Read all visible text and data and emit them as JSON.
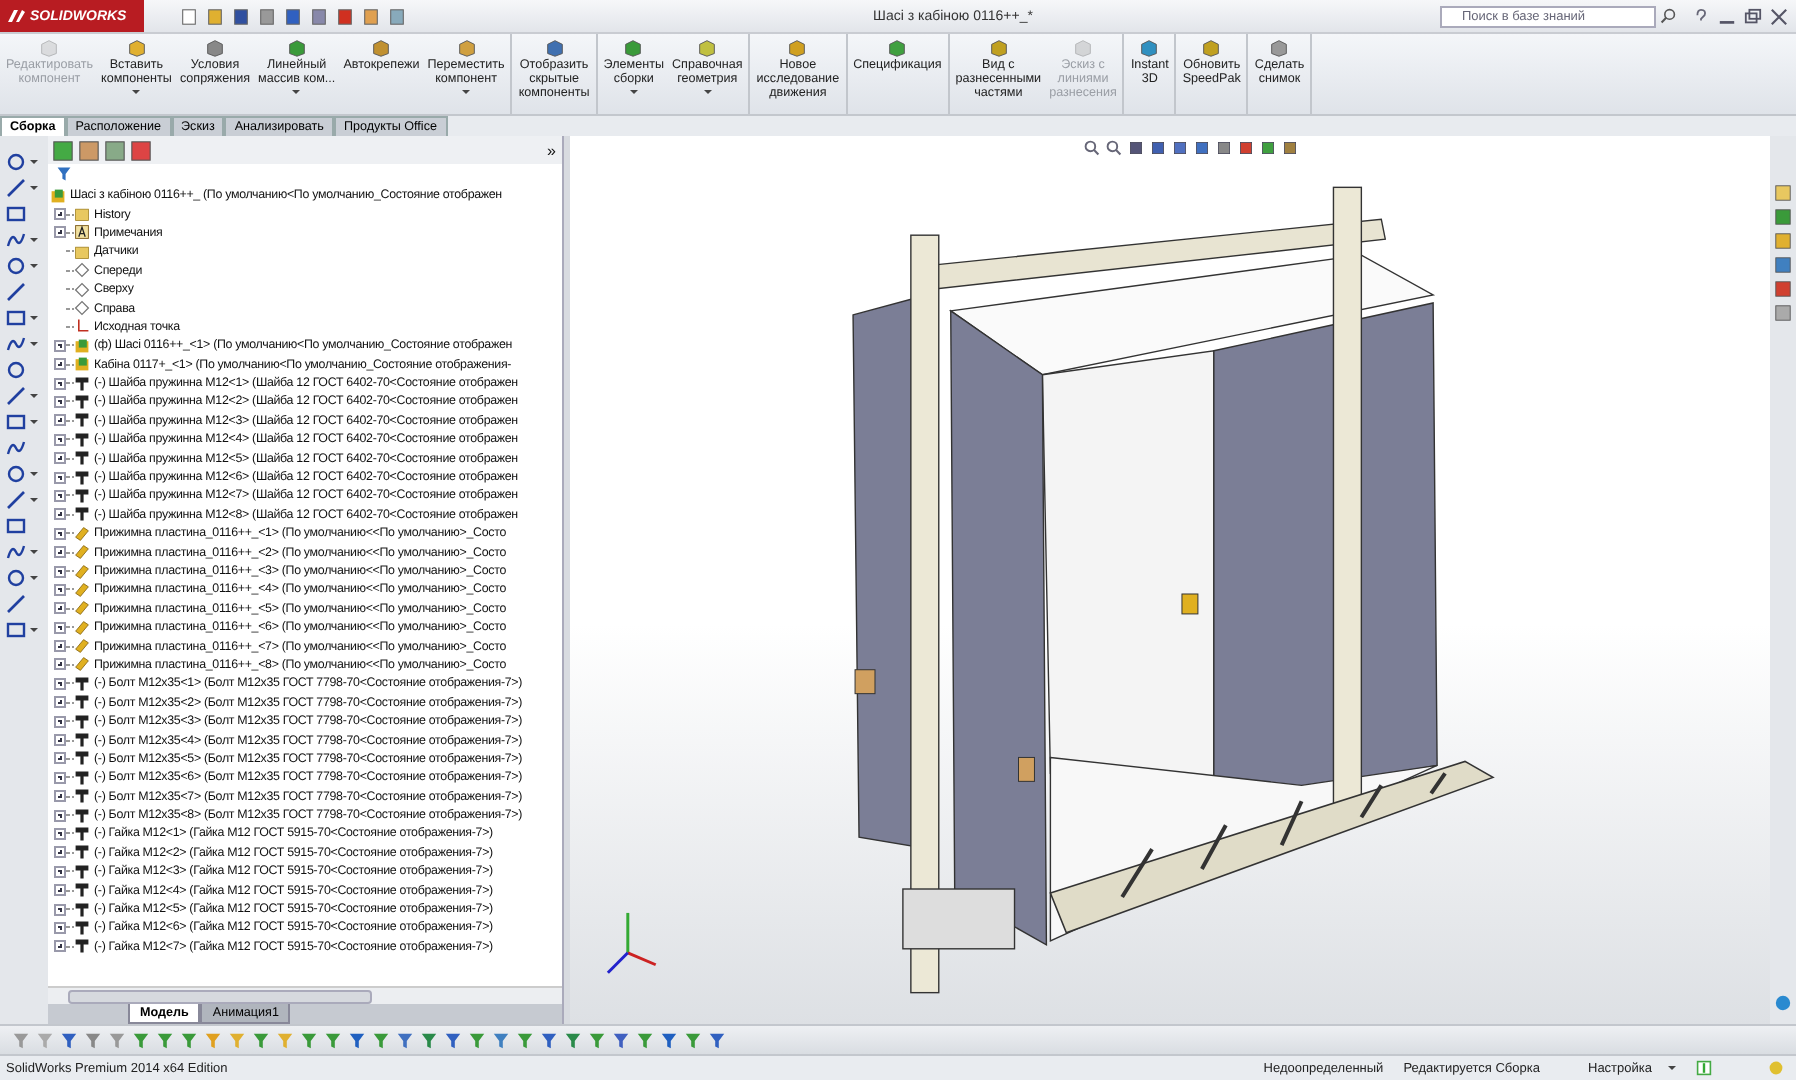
{
  "title_bar": {
    "logo": "SOLIDWORKS",
    "title": "Шасі з кабіною 0116++_*",
    "search": {
      "placeholder": "Поиск в базе знаний"
    }
  },
  "command_groups": [
    [
      {
        "label": "Редактировать\nкомпонент",
        "disabled": true,
        "dropdown": false
      },
      {
        "label": "Вставить\nкомпоненты",
        "disabled": false,
        "dropdown": true
      },
      {
        "label": "Условия\nсопряжения",
        "disabled": false,
        "dropdown": false
      },
      {
        "label": "Линейный\nмассив ком...",
        "disabled": false,
        "dropdown": true
      },
      {
        "label": "Автокрепежи",
        "disabled": false,
        "dropdown": false
      },
      {
        "label": "Переместить\nкомпонент",
        "disabled": false,
        "dropdown": true
      }
    ],
    [
      {
        "label": "Отобразить\nскрытые\nкомпоненты",
        "disabled": false,
        "dropdown": false
      }
    ],
    [
      {
        "label": "Элементы\nсборки",
        "disabled": false,
        "dropdown": true
      },
      {
        "label": "Справочная\nгеометрия",
        "disabled": false,
        "dropdown": true
      }
    ],
    [
      {
        "label": "Новое\nисследование\nдвижения",
        "disabled": false,
        "dropdown": false
      }
    ],
    [
      {
        "label": "Спецификация",
        "disabled": false,
        "dropdown": false
      }
    ],
    [
      {
        "label": "Вид с\nразнесенными\nчастями",
        "disabled": false,
        "dropdown": false
      },
      {
        "label": "Эскиз с\nлиниями\nразнесения",
        "disabled": true,
        "dropdown": false
      }
    ],
    [
      {
        "label": "Instant\n3D",
        "disabled": false,
        "dropdown": false
      }
    ],
    [
      {
        "label": "Обновить\nSpeedPak",
        "disabled": false,
        "dropdown": false
      }
    ],
    [
      {
        "label": "Сделать\nснимок",
        "disabled": false,
        "dropdown": false
      }
    ]
  ],
  "tabs": [
    {
      "label": "Сборка",
      "selected": true
    },
    {
      "label": "Расположение",
      "selected": false
    },
    {
      "label": "Эскиз",
      "selected": false
    },
    {
      "label": "Анализировать",
      "selected": false
    },
    {
      "label": "Продукты Office",
      "selected": false
    }
  ],
  "tree": {
    "more": "»",
    "root": {
      "label": "Шасі з кабіною 0116++_  (По умолчанию<По умолчанию_Состояние отображен",
      "children": [
        {
          "label": "History",
          "kind": "history",
          "expandable": true
        },
        {
          "label": "Примечания",
          "kind": "annotations",
          "expandable": true
        },
        {
          "label": "Датчики",
          "kind": "sensors",
          "expandable": false
        },
        {
          "label": "Спереди",
          "kind": "plane",
          "expandable": false
        },
        {
          "label": "Сверху",
          "kind": "plane",
          "expandable": false
        },
        {
          "label": "Справа",
          "kind": "plane",
          "expandable": false
        },
        {
          "label": "Исходная точка",
          "kind": "origin",
          "expandable": false
        },
        {
          "label": "(ф) Шасі 0116++_<1> (По умолчанию<По умолчанию_Состояние отображен",
          "kind": "assembly",
          "expandable": true
        },
        {
          "label": "Кабіна 0117+_<1> (По умолчанию<По умолчанию_Состояние отображения-",
          "kind": "assembly",
          "expandable": true
        },
        {
          "label": "(-) Шайба пружинна M12<1>  (Шайба 12 ГОСТ 6402-70<Состояние отображен",
          "kind": "toolbox",
          "expandable": true
        },
        {
          "label": "(-) Шайба пружинна M12<2>  (Шайба 12 ГОСТ 6402-70<Состояние отображен",
          "kind": "toolbox",
          "expandable": true
        },
        {
          "label": "(-) Шайба пружинна M12<3>  (Шайба 12 ГОСТ 6402-70<Состояние отображен",
          "kind": "toolbox",
          "expandable": true
        },
        {
          "label": "(-) Шайба пружинна M12<4>  (Шайба 12 ГОСТ 6402-70<Состояние отображен",
          "kind": "toolbox",
          "expandable": true
        },
        {
          "label": "(-) Шайба пружинна M12<5>  (Шайба 12 ГОСТ 6402-70<Состояние отображен",
          "kind": "toolbox",
          "expandable": true
        },
        {
          "label": "(-) Шайба пружинна M12<6>  (Шайба 12 ГОСТ 6402-70<Состояние отображен",
          "kind": "toolbox",
          "expandable": true
        },
        {
          "label": "(-) Шайба пружинна M12<7>  (Шайба 12 ГОСТ 6402-70<Состояние отображен",
          "kind": "toolbox",
          "expandable": true
        },
        {
          "label": "(-) Шайба пружинна M12<8>  (Шайба 12 ГОСТ 6402-70<Состояние отображен",
          "kind": "toolbox",
          "expandable": true
        },
        {
          "label": "Прижимна пластина_0116++_<1> (По умолчанию<<По умолчанию>_Состо",
          "kind": "part",
          "expandable": true
        },
        {
          "label": "Прижимна пластина_0116++_<2> (По умолчанию<<По умолчанию>_Состо",
          "kind": "part",
          "expandable": true
        },
        {
          "label": "Прижимна пластина_0116++_<3> (По умолчанию<<По умолчанию>_Состо",
          "kind": "part",
          "expandable": true
        },
        {
          "label": "Прижимна пластина_0116++_<4> (По умолчанию<<По умолчанию>_Состо",
          "kind": "part",
          "expandable": true
        },
        {
          "label": "Прижимна пластина_0116++_<5> (По умолчанию<<По умолчанию>_Состо",
          "kind": "part",
          "expandable": true
        },
        {
          "label": "Прижимна пластина_0116++_<6> (По умолчанию<<По умолчанию>_Состо",
          "kind": "part",
          "expandable": true
        },
        {
          "label": "Прижимна пластина_0116++_<7> (По умолчанию<<По умолчанию>_Состо",
          "kind": "part",
          "expandable": true
        },
        {
          "label": "Прижимна пластина_0116++_<8> (По умолчанию<<По умолчанию>_Состо",
          "kind": "part",
          "expandable": true
        },
        {
          "label": "(-) Болт M12x35<1> (Болт M12x35 ГОСТ 7798-70<Состояние отображения-7>)",
          "kind": "toolbox",
          "expandable": true
        },
        {
          "label": "(-) Болт M12x35<2> (Болт M12x35 ГОСТ 7798-70<Состояние отображения-7>)",
          "kind": "toolbox",
          "expandable": true
        },
        {
          "label": "(-) Болт M12x35<3> (Болт M12x35 ГОСТ 7798-70<Состояние отображения-7>)",
          "kind": "toolbox",
          "expandable": true
        },
        {
          "label": "(-) Болт M12x35<4> (Болт M12x35 ГОСТ 7798-70<Состояние отображения-7>)",
          "kind": "toolbox",
          "expandable": true
        },
        {
          "label": "(-) Болт M12x35<5> (Болт M12x35 ГОСТ 7798-70<Состояние отображения-7>)",
          "kind": "toolbox",
          "expandable": true
        },
        {
          "label": "(-) Болт M12x35<6> (Болт M12x35 ГОСТ 7798-70<Состояние отображения-7>)",
          "kind": "toolbox",
          "expandable": true
        },
        {
          "label": "(-) Болт M12x35<7> (Болт M12x35 ГОСТ 7798-70<Состояние отображения-7>)",
          "kind": "toolbox",
          "expandable": true
        },
        {
          "label": "(-) Болт M12x35<8> (Болт M12x35 ГОСТ 7798-70<Состояние отображения-7>)",
          "kind": "toolbox",
          "expandable": true
        },
        {
          "label": "(-) Гайка M12<1> (Гайка M12 ГОСТ 5915-70<Состояние отображения-7>)",
          "kind": "toolbox",
          "expandable": true
        },
        {
          "label": "(-) Гайка M12<2> (Гайка M12 ГОСТ 5915-70<Состояние отображения-7>)",
          "kind": "toolbox",
          "expandable": true
        },
        {
          "label": "(-) Гайка M12<3> (Гайка M12 ГОСТ 5915-70<Состояние отображения-7>)",
          "kind": "toolbox",
          "expandable": true
        },
        {
          "label": "(-) Гайка M12<4> (Гайка M12 ГОСТ 5915-70<Состояние отображения-7>)",
          "kind": "toolbox",
          "expandable": true
        },
        {
          "label": "(-) Гайка M12<5> (Гайка M12 ГОСТ 5915-70<Состояние отображения-7>)",
          "kind": "toolbox",
          "expandable": true
        },
        {
          "label": "(-) Гайка M12<6> (Гайка M12 ГОСТ 5915-70<Состояние отображения-7>)",
          "kind": "toolbox",
          "expandable": true
        },
        {
          "label": "(-) Гайка M12<7> (Гайка M12 ГОСТ 5915-70<Состояние отображения-7>)",
          "kind": "toolbox",
          "expandable": true
        }
      ]
    }
  },
  "bottom_tabs": [
    {
      "label": "Модель",
      "selected": true
    },
    {
      "label": "Анимация1",
      "selected": false
    }
  ],
  "status_bar": {
    "product": "SolidWorks Premium 2014 x64 Edition",
    "state": "Недоопределенный",
    "mode": "Редактируется Сборка",
    "units": "Настройка"
  }
}
